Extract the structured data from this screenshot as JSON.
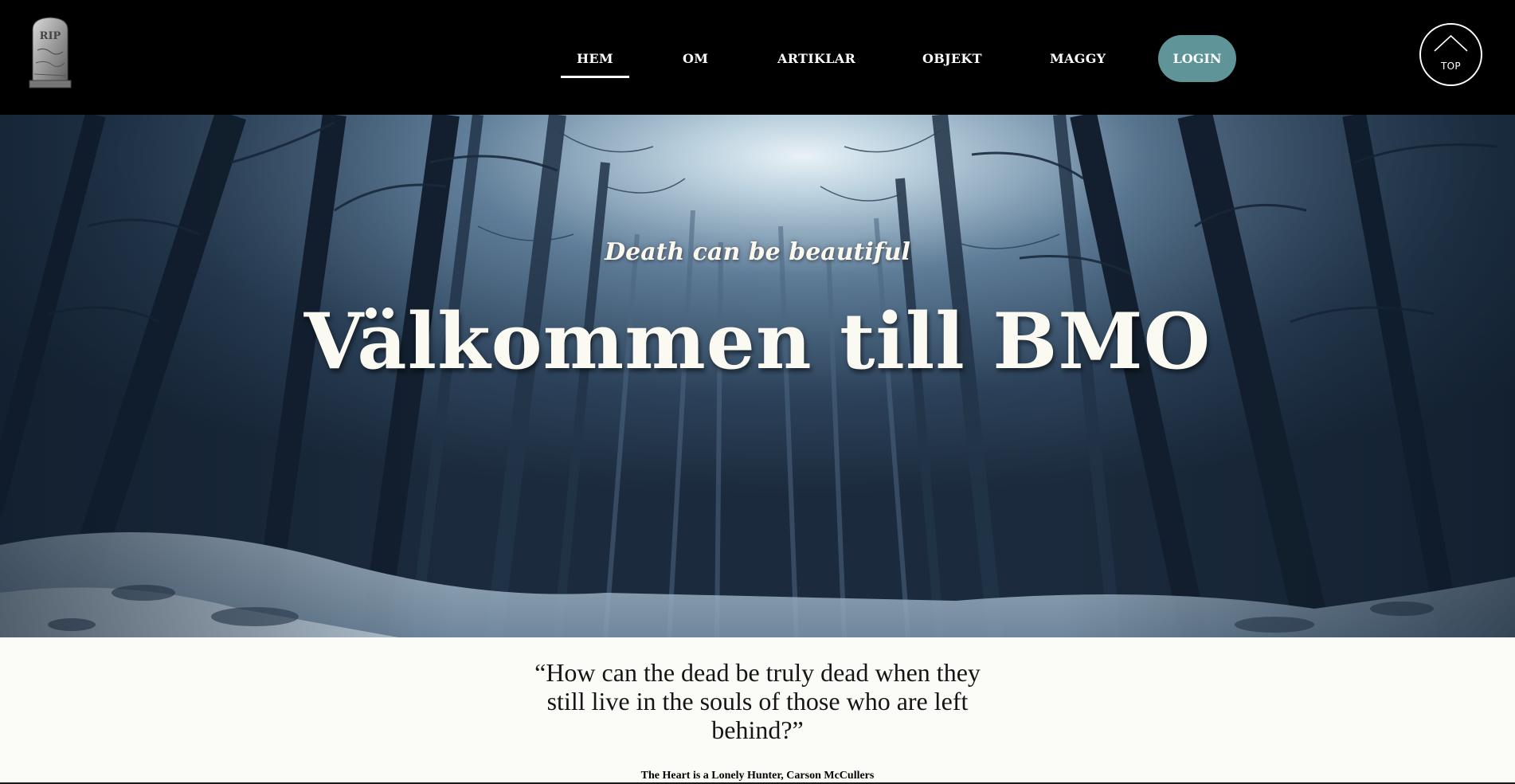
{
  "header": {
    "logo_icon": "rip-tombstone-icon",
    "nav": [
      {
        "label": "HEM",
        "active": true
      },
      {
        "label": "OM",
        "active": false
      },
      {
        "label": "ARTIKLAR",
        "active": false
      },
      {
        "label": "OBJEKT",
        "active": false
      },
      {
        "label": "MAGGY",
        "active": false
      }
    ],
    "login_label": "LOGIN",
    "login_color": "#5f9599",
    "top_label": "TOP",
    "top_icon": "chevron-up-icon"
  },
  "hero": {
    "background": "snowy-forest-night-image",
    "tagline": "Death can be beautiful",
    "title": "Välkommen till BMO"
  },
  "quote": {
    "text": "“How can the dead be truly dead when they still live in the souls of those who are left behind?”",
    "source": "The Heart is a Lonely Hunter, Carson McCullers"
  }
}
